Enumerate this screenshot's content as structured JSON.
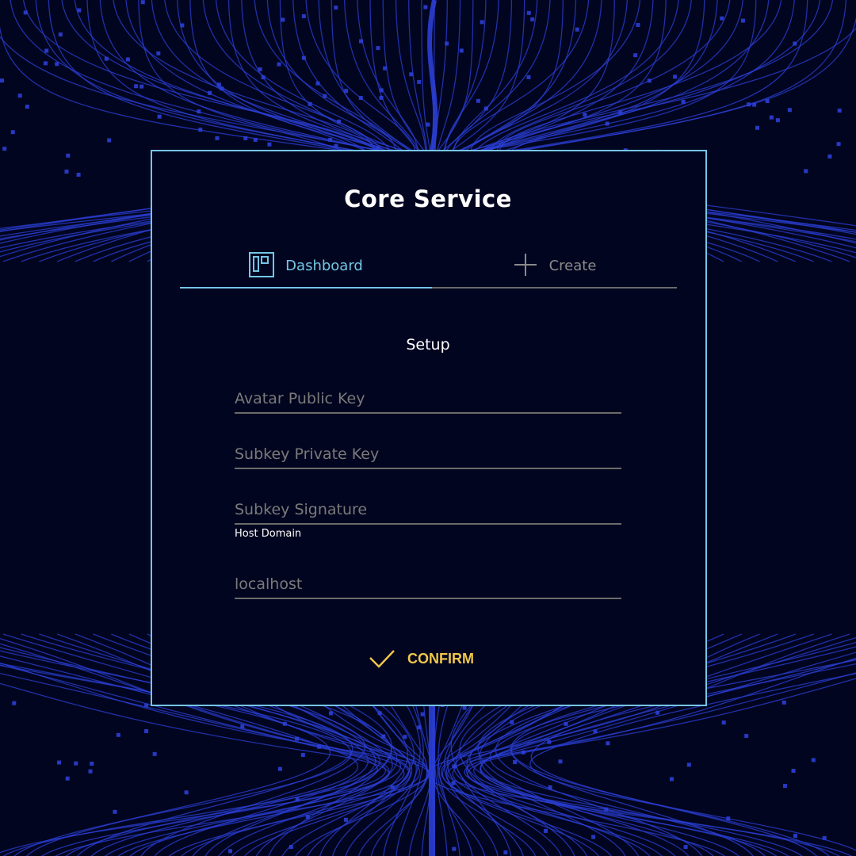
{
  "app": {
    "title": "Core Service"
  },
  "tabs": [
    {
      "label": "Dashboard",
      "icon": "dashboard-icon",
      "active": true
    },
    {
      "label": "Create",
      "icon": "plus-icon",
      "active": false
    }
  ],
  "form": {
    "section_title": "Setup",
    "fields": [
      {
        "placeholder": "Avatar Public Key",
        "value": ""
      },
      {
        "placeholder": "Subkey Private Key",
        "value": ""
      },
      {
        "placeholder": "Subkey Signature",
        "value": ""
      },
      {
        "label": "Host Domain",
        "placeholder": "localhost",
        "value": ""
      }
    ],
    "confirm_label": "CONFIRM"
  },
  "colors": {
    "background": "#02051f",
    "accent": "#74c6e6",
    "confirm": "#f0c74a",
    "lines": "#2b3fd6"
  }
}
